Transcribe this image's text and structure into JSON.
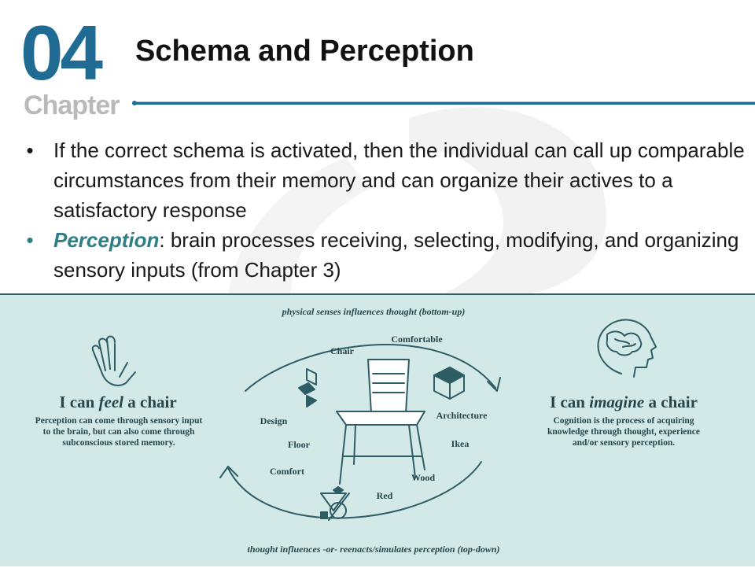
{
  "header": {
    "chapter_number": "04",
    "chapter_word": "Chapter",
    "title": "Schema and Perception"
  },
  "bullets": [
    {
      "text": "If the correct schema is activated, then the individual can call up comparable circumstances from their memory and can organize their actives to a satisfactory response"
    },
    {
      "term": "Perception",
      "text": ":  brain processes receiving, selecting, modifying, and organizing sensory inputs (from Chapter 3)"
    }
  ],
  "diagram": {
    "top_caption": "physical senses influences thought (bottom-up)",
    "bottom_caption": "thought influences -or- reenacts/simulates perception (top-down)",
    "left": {
      "heading_pre": "I can ",
      "heading_em": "feel",
      "heading_post": " a chair",
      "description": "Perception can come through sensory input to the brain, but can also come through subconscious stored memory."
    },
    "right": {
      "heading_pre": "I can ",
      "heading_em": "imagine",
      "heading_post": " a chair",
      "description": "Cognition is the process of acquiring knowledge through thought, experience and/or sensory perception."
    },
    "words": {
      "chair": "Chair",
      "comfortable": "Comfortable",
      "design": "Design",
      "architecture": "Architecture",
      "floor": "Floor",
      "ikea": "Ikea",
      "comfort": "Comfort",
      "wood": "Wood",
      "red": "Red"
    }
  },
  "colors": {
    "chapter_blue": "#1f6b93",
    "teal_accent": "#2f7f86",
    "panel_bg": "#d3e9e8",
    "diagram_ink": "#2f5d65"
  }
}
